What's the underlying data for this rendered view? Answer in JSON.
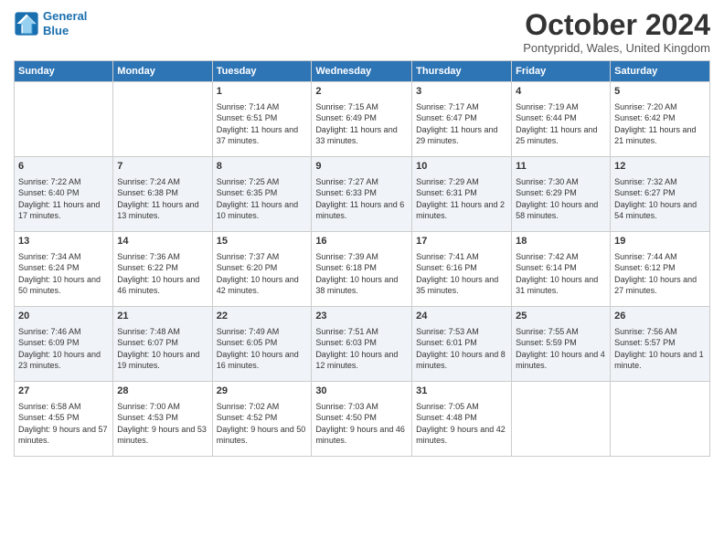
{
  "header": {
    "logo_line1": "General",
    "logo_line2": "Blue",
    "month": "October 2024",
    "location": "Pontypridd, Wales, United Kingdom"
  },
  "days_of_week": [
    "Sunday",
    "Monday",
    "Tuesday",
    "Wednesday",
    "Thursday",
    "Friday",
    "Saturday"
  ],
  "weeks": [
    [
      {
        "day": "",
        "info": ""
      },
      {
        "day": "",
        "info": ""
      },
      {
        "day": "1",
        "info": "Sunrise: 7:14 AM\nSunset: 6:51 PM\nDaylight: 11 hours and 37 minutes."
      },
      {
        "day": "2",
        "info": "Sunrise: 7:15 AM\nSunset: 6:49 PM\nDaylight: 11 hours and 33 minutes."
      },
      {
        "day": "3",
        "info": "Sunrise: 7:17 AM\nSunset: 6:47 PM\nDaylight: 11 hours and 29 minutes."
      },
      {
        "day": "4",
        "info": "Sunrise: 7:19 AM\nSunset: 6:44 PM\nDaylight: 11 hours and 25 minutes."
      },
      {
        "day": "5",
        "info": "Sunrise: 7:20 AM\nSunset: 6:42 PM\nDaylight: 11 hours and 21 minutes."
      }
    ],
    [
      {
        "day": "6",
        "info": "Sunrise: 7:22 AM\nSunset: 6:40 PM\nDaylight: 11 hours and 17 minutes."
      },
      {
        "day": "7",
        "info": "Sunrise: 7:24 AM\nSunset: 6:38 PM\nDaylight: 11 hours and 13 minutes."
      },
      {
        "day": "8",
        "info": "Sunrise: 7:25 AM\nSunset: 6:35 PM\nDaylight: 11 hours and 10 minutes."
      },
      {
        "day": "9",
        "info": "Sunrise: 7:27 AM\nSunset: 6:33 PM\nDaylight: 11 hours and 6 minutes."
      },
      {
        "day": "10",
        "info": "Sunrise: 7:29 AM\nSunset: 6:31 PM\nDaylight: 11 hours and 2 minutes."
      },
      {
        "day": "11",
        "info": "Sunrise: 7:30 AM\nSunset: 6:29 PM\nDaylight: 10 hours and 58 minutes."
      },
      {
        "day": "12",
        "info": "Sunrise: 7:32 AM\nSunset: 6:27 PM\nDaylight: 10 hours and 54 minutes."
      }
    ],
    [
      {
        "day": "13",
        "info": "Sunrise: 7:34 AM\nSunset: 6:24 PM\nDaylight: 10 hours and 50 minutes."
      },
      {
        "day": "14",
        "info": "Sunrise: 7:36 AM\nSunset: 6:22 PM\nDaylight: 10 hours and 46 minutes."
      },
      {
        "day": "15",
        "info": "Sunrise: 7:37 AM\nSunset: 6:20 PM\nDaylight: 10 hours and 42 minutes."
      },
      {
        "day": "16",
        "info": "Sunrise: 7:39 AM\nSunset: 6:18 PM\nDaylight: 10 hours and 38 minutes."
      },
      {
        "day": "17",
        "info": "Sunrise: 7:41 AM\nSunset: 6:16 PM\nDaylight: 10 hours and 35 minutes."
      },
      {
        "day": "18",
        "info": "Sunrise: 7:42 AM\nSunset: 6:14 PM\nDaylight: 10 hours and 31 minutes."
      },
      {
        "day": "19",
        "info": "Sunrise: 7:44 AM\nSunset: 6:12 PM\nDaylight: 10 hours and 27 minutes."
      }
    ],
    [
      {
        "day": "20",
        "info": "Sunrise: 7:46 AM\nSunset: 6:09 PM\nDaylight: 10 hours and 23 minutes."
      },
      {
        "day": "21",
        "info": "Sunrise: 7:48 AM\nSunset: 6:07 PM\nDaylight: 10 hours and 19 minutes."
      },
      {
        "day": "22",
        "info": "Sunrise: 7:49 AM\nSunset: 6:05 PM\nDaylight: 10 hours and 16 minutes."
      },
      {
        "day": "23",
        "info": "Sunrise: 7:51 AM\nSunset: 6:03 PM\nDaylight: 10 hours and 12 minutes."
      },
      {
        "day": "24",
        "info": "Sunrise: 7:53 AM\nSunset: 6:01 PM\nDaylight: 10 hours and 8 minutes."
      },
      {
        "day": "25",
        "info": "Sunrise: 7:55 AM\nSunset: 5:59 PM\nDaylight: 10 hours and 4 minutes."
      },
      {
        "day": "26",
        "info": "Sunrise: 7:56 AM\nSunset: 5:57 PM\nDaylight: 10 hours and 1 minute."
      }
    ],
    [
      {
        "day": "27",
        "info": "Sunrise: 6:58 AM\nSunset: 4:55 PM\nDaylight: 9 hours and 57 minutes."
      },
      {
        "day": "28",
        "info": "Sunrise: 7:00 AM\nSunset: 4:53 PM\nDaylight: 9 hours and 53 minutes."
      },
      {
        "day": "29",
        "info": "Sunrise: 7:02 AM\nSunset: 4:52 PM\nDaylight: 9 hours and 50 minutes."
      },
      {
        "day": "30",
        "info": "Sunrise: 7:03 AM\nSunset: 4:50 PM\nDaylight: 9 hours and 46 minutes."
      },
      {
        "day": "31",
        "info": "Sunrise: 7:05 AM\nSunset: 4:48 PM\nDaylight: 9 hours and 42 minutes."
      },
      {
        "day": "",
        "info": ""
      },
      {
        "day": "",
        "info": ""
      }
    ]
  ]
}
